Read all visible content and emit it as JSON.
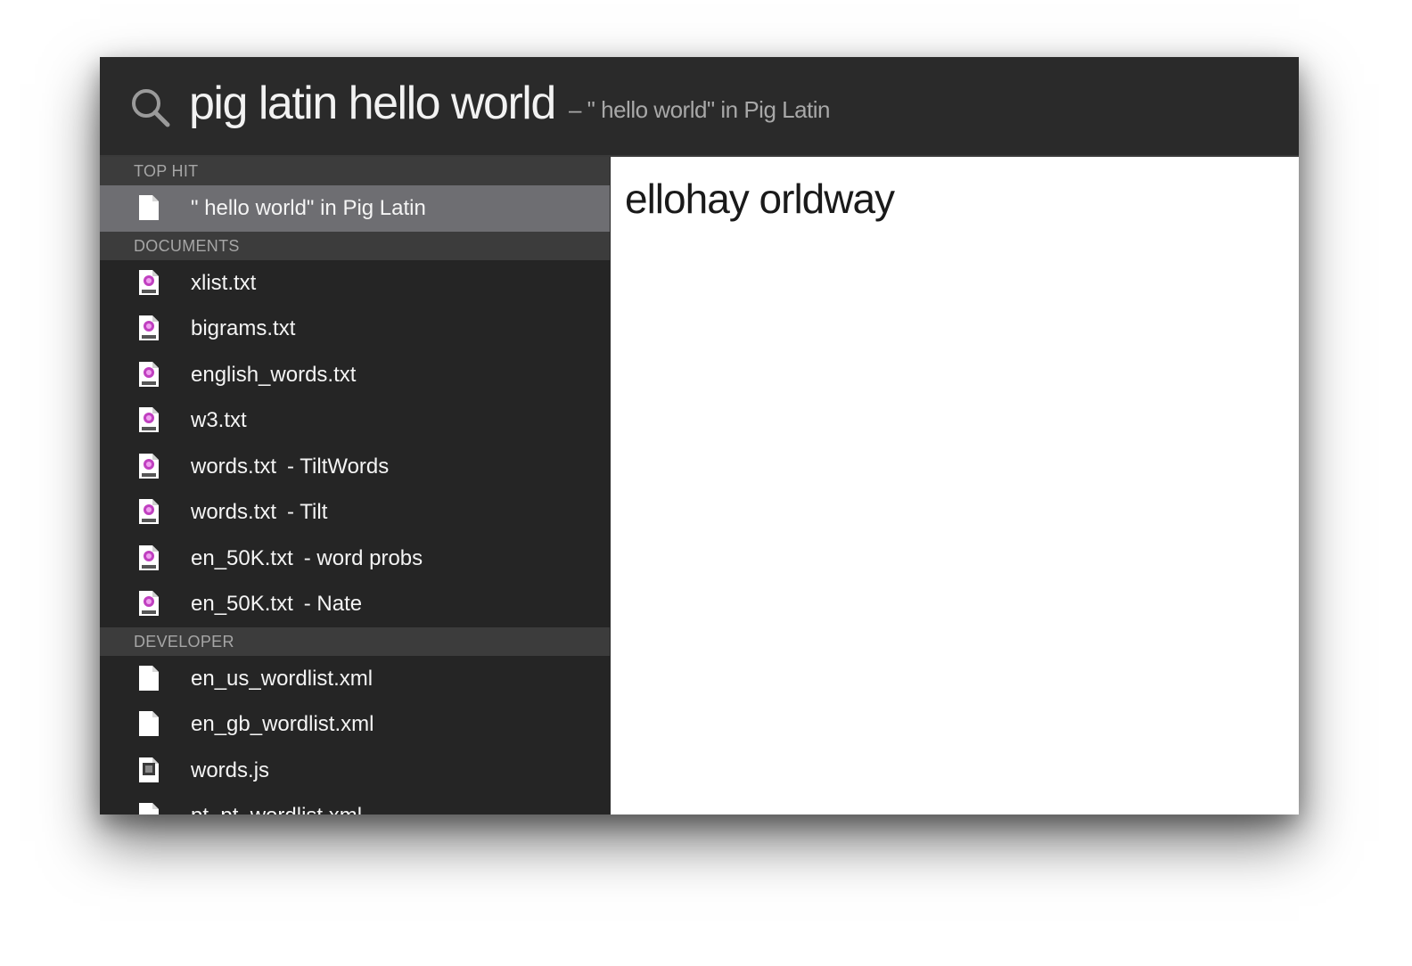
{
  "search": {
    "query": "pig latin hello world",
    "hint": "– \" hello world\" in Pig Latin"
  },
  "sections": {
    "top_hit": {
      "header": "TOP HIT",
      "items": [
        {
          "label": "\" hello world\" in Pig Latin",
          "sub": "",
          "icon": "document-icon"
        }
      ]
    },
    "documents": {
      "header": "DOCUMENTS",
      "items": [
        {
          "label": "xlist.txt",
          "sub": "",
          "icon": "text-file-icon"
        },
        {
          "label": "bigrams.txt",
          "sub": "",
          "icon": "text-file-icon"
        },
        {
          "label": "english_words.txt",
          "sub": "",
          "icon": "text-file-icon"
        },
        {
          "label": "w3.txt",
          "sub": "",
          "icon": "text-file-icon"
        },
        {
          "label": "words.txt",
          "sub": "- TiltWords",
          "icon": "text-file-icon"
        },
        {
          "label": "words.txt",
          "sub": "- Tilt",
          "icon": "text-file-icon"
        },
        {
          "label": "en_50K.txt",
          "sub": "- word probs",
          "icon": "text-file-icon"
        },
        {
          "label": "en_50K.txt",
          "sub": "- Nate",
          "icon": "text-file-icon"
        }
      ]
    },
    "developer": {
      "header": "DEVELOPER",
      "items": [
        {
          "label": "en_us_wordlist.xml",
          "sub": "",
          "icon": "document-icon"
        },
        {
          "label": "en_gb_wordlist.xml",
          "sub": "",
          "icon": "document-icon"
        },
        {
          "label": "words.js",
          "sub": "",
          "icon": "js-file-icon"
        },
        {
          "label": "pt_pt_wordlist.xml",
          "sub": "",
          "icon": "document-icon"
        }
      ]
    }
  },
  "preview": {
    "result": "ellohay orldway"
  },
  "colors": {
    "window_bg": "#2a2a2a",
    "sidebar_bg": "#252525",
    "section_header_bg": "#3c3c3c",
    "selected_row": "#6e6e72",
    "preview_bg": "#ffffff"
  }
}
